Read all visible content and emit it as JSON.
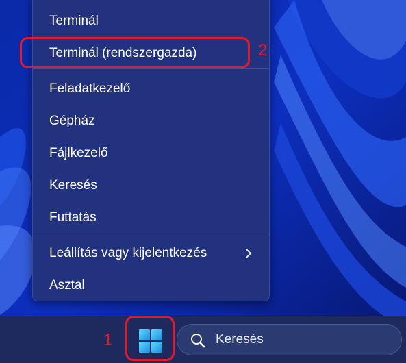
{
  "context_menu": {
    "items": [
      {
        "label": "Terminál"
      },
      {
        "label": "Terminál (rendszergazda)"
      },
      {
        "label": "Feladatkezelő"
      },
      {
        "label": "Gépház"
      },
      {
        "label": "Fájlkezelő"
      },
      {
        "label": "Keresés"
      },
      {
        "label": "Futtatás"
      },
      {
        "label": "Leállítás vagy kijelentkezés"
      },
      {
        "label": "Asztal"
      }
    ],
    "submenu_icon": "chevron-right-icon"
  },
  "annotations": {
    "step1": "1",
    "step2": "2",
    "color": "#e8182a"
  },
  "taskbar": {
    "start_icon": "windows-logo-icon",
    "search_placeholder": "Keresés",
    "search_icon": "search-icon"
  },
  "colors": {
    "menu_bg": "#23327e",
    "taskbar_bg": "#1e2a5e",
    "start_icon_color": "#3ec6f5"
  }
}
